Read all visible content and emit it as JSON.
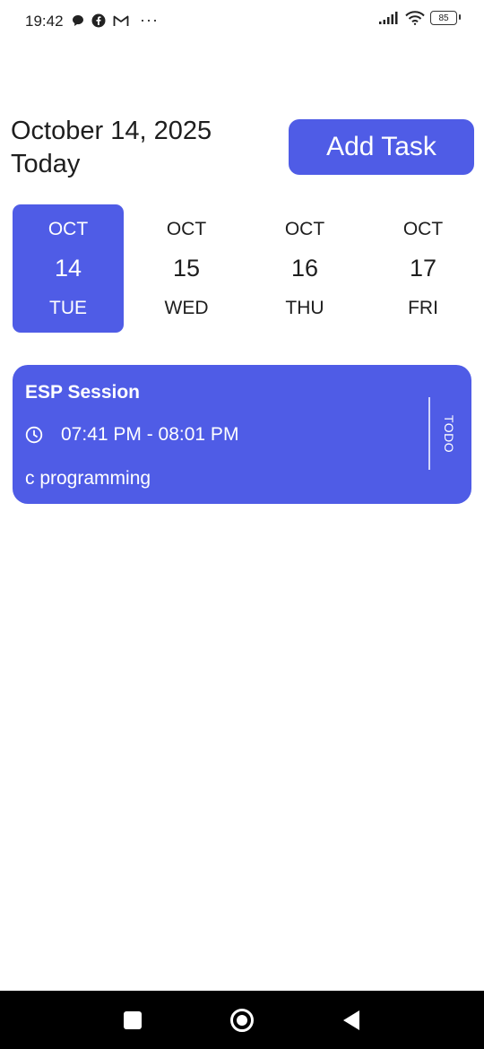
{
  "status_bar": {
    "time": "19:42",
    "overflow_dots": "···",
    "battery": "85"
  },
  "header": {
    "date": "October 14, 2025",
    "subtitle": "Today",
    "add_task_label": "Add Task"
  },
  "days": [
    {
      "month": "OCT",
      "day": "14",
      "weekday": "TUE",
      "selected": true
    },
    {
      "month": "OCT",
      "day": "15",
      "weekday": "WED",
      "selected": false
    },
    {
      "month": "OCT",
      "day": "16",
      "weekday": "THU",
      "selected": false
    },
    {
      "month": "OCT",
      "day": "17",
      "weekday": "FRI",
      "selected": false
    }
  ],
  "tasks": [
    {
      "title": "ESP Session",
      "time": "07:41 PM - 08:01 PM",
      "note": "c programming",
      "status": "TODO"
    }
  ],
  "colors": {
    "accent": "#4f5ce6"
  }
}
